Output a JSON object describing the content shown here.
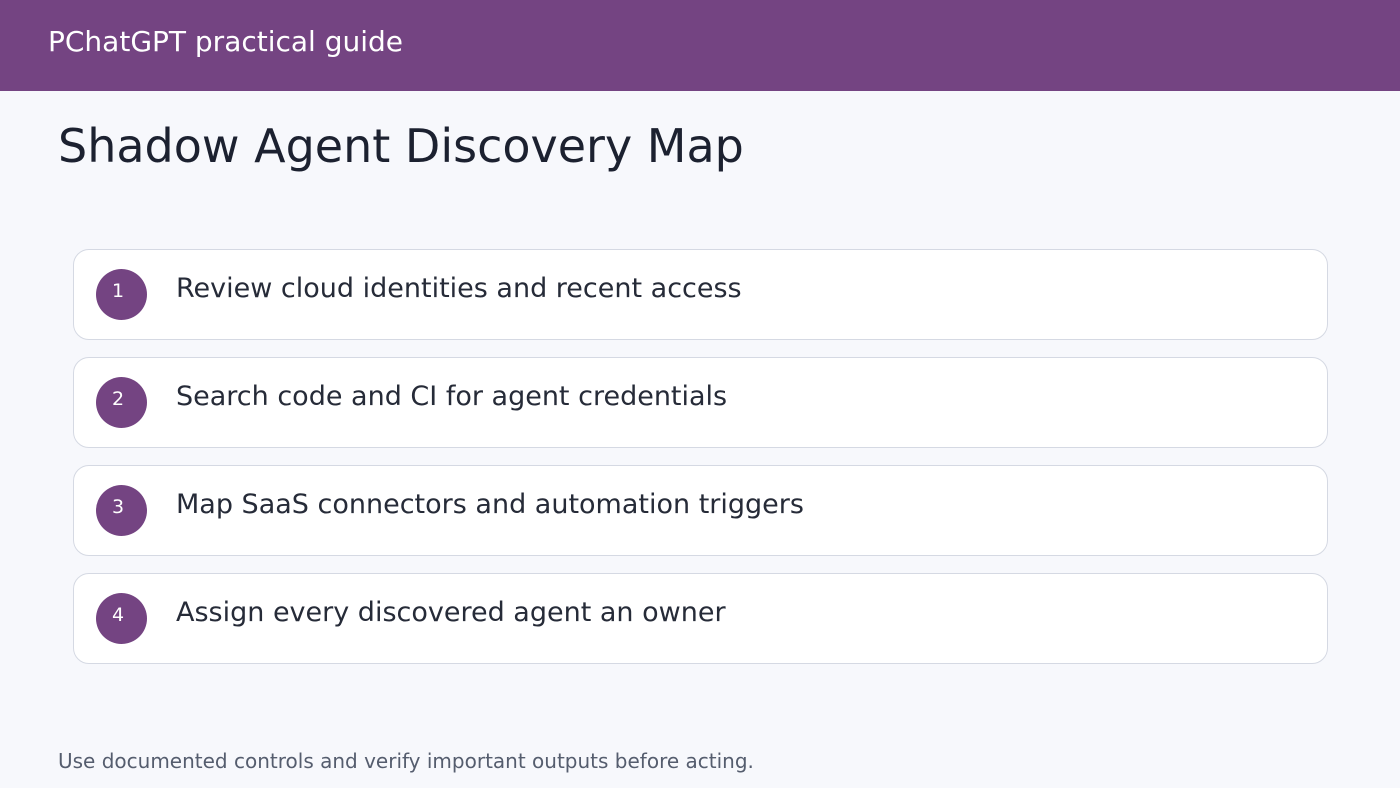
{
  "header": {
    "brand": "PChatGPT practical guide"
  },
  "page": {
    "title": "Shadow Agent Discovery Map"
  },
  "steps": [
    {
      "number": "1",
      "text": "Review cloud identities and recent access"
    },
    {
      "number": "2",
      "text": "Search code and CI for agent credentials"
    },
    {
      "number": "3",
      "text": "Map SaaS connectors and automation triggers"
    },
    {
      "number": "4",
      "text": "Assign every discovered agent an owner"
    }
  ],
  "footer": {
    "note": "Use documented controls and verify important outputs before acting."
  },
  "colors": {
    "accent": "#744482",
    "background": "#f7f8fc",
    "card_border": "#d5d9e3"
  }
}
